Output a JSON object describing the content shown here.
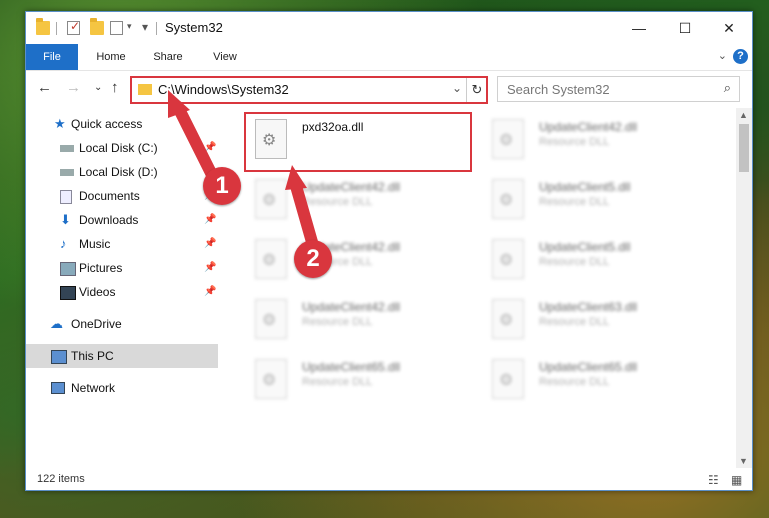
{
  "window": {
    "title": "System32",
    "ribbon_tabs": [
      {
        "label": "File"
      },
      {
        "label": "Home"
      },
      {
        "label": "Share"
      },
      {
        "label": "View"
      }
    ],
    "help": "?"
  },
  "address": {
    "path": "C:\\Windows\\System32",
    "search_placeholder": "Search System32"
  },
  "sidebar": {
    "items": [
      {
        "label": "Quick access"
      },
      {
        "label": "Local Disk (C:)"
      },
      {
        "label": "Local Disk (D:)"
      },
      {
        "label": "Documents"
      },
      {
        "label": "Downloads"
      },
      {
        "label": "Music"
      },
      {
        "label": "Pictures"
      },
      {
        "label": "Videos"
      },
      {
        "label": "OneDrive"
      },
      {
        "label": "This PC"
      },
      {
        "label": "Network"
      }
    ]
  },
  "files": [
    {
      "name": "pxd32oa.dll",
      "type": ""
    },
    {
      "name": "UpdateClient42.dll",
      "type": "Resource DLL"
    },
    {
      "name": "UpdateClient42.dll",
      "type": "Resource DLL"
    },
    {
      "name": "UpdateClient5.dll",
      "type": "Resource DLL"
    },
    {
      "name": "UpdateClient42.dll",
      "type": "Resource DLL"
    },
    {
      "name": "UpdateClient5.dll",
      "type": "Resource DLL"
    },
    {
      "name": "UpdateClient42.dll",
      "type": "Resource DLL"
    },
    {
      "name": "UpdateClient63.dll",
      "type": "Resource DLL"
    },
    {
      "name": "UpdateClient65.dll",
      "type": "Resource DLL"
    },
    {
      "name": "UpdateClient65.dll",
      "type": "Resource DLL"
    }
  ],
  "status": {
    "items": "122 items"
  },
  "callouts": {
    "one": "1",
    "two": "2"
  },
  "colors": {
    "accent": "#1e6fc8",
    "highlight": "#d9363e"
  }
}
